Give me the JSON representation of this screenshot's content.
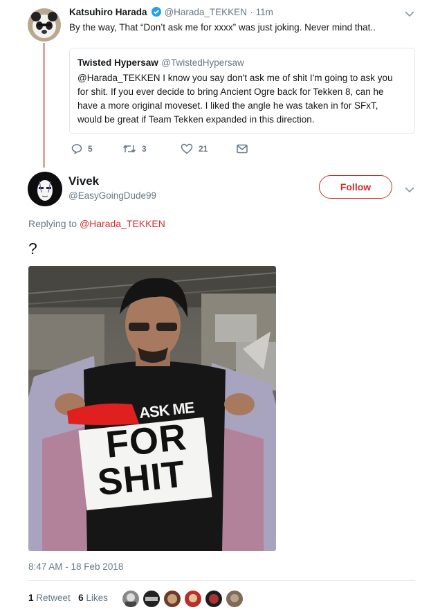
{
  "harada_tweet": {
    "name": "Katsuhiro Harada",
    "handle": "@Harada_TEKKEN",
    "time": "· 11m",
    "text": "By the way, That “Don’t ask me for xxxx” was just joking. Never mind that..",
    "quote": {
      "name": "Twisted Hypersaw",
      "handle": "@TwistedHypersaw",
      "text": "@Harada_TEKKEN I know you say don't ask me of shit I'm going to ask you for shit. If you ever decide to bring Ancient Ogre back for Tekken 8, can he have a more original moveset. I liked the angle he was taken in for SFxT, would be great if Team Tekken expanded in this direction."
    },
    "actions": {
      "replies": "5",
      "retweets": "3",
      "likes": "21"
    }
  },
  "main_tweet": {
    "name": "Vivek",
    "handle": "@EasyGoingDude99",
    "follow_label": "Follow",
    "replying_prefix": "Replying to",
    "replying_to": "@Harada_TEKKEN",
    "text": "?",
    "shirt": {
      "line1": "ASK ME",
      "line2": "FOR",
      "line3": "SHIT"
    },
    "timestamp": "8:47 AM - 18 Feb 2018",
    "retweet_count": "1",
    "retweet_label": "Retweet",
    "like_count": "6",
    "like_label": "Likes"
  },
  "colors": {
    "accent": "#d42b2b",
    "verified": "#1da1f2",
    "thread": "#e0a3a3"
  }
}
